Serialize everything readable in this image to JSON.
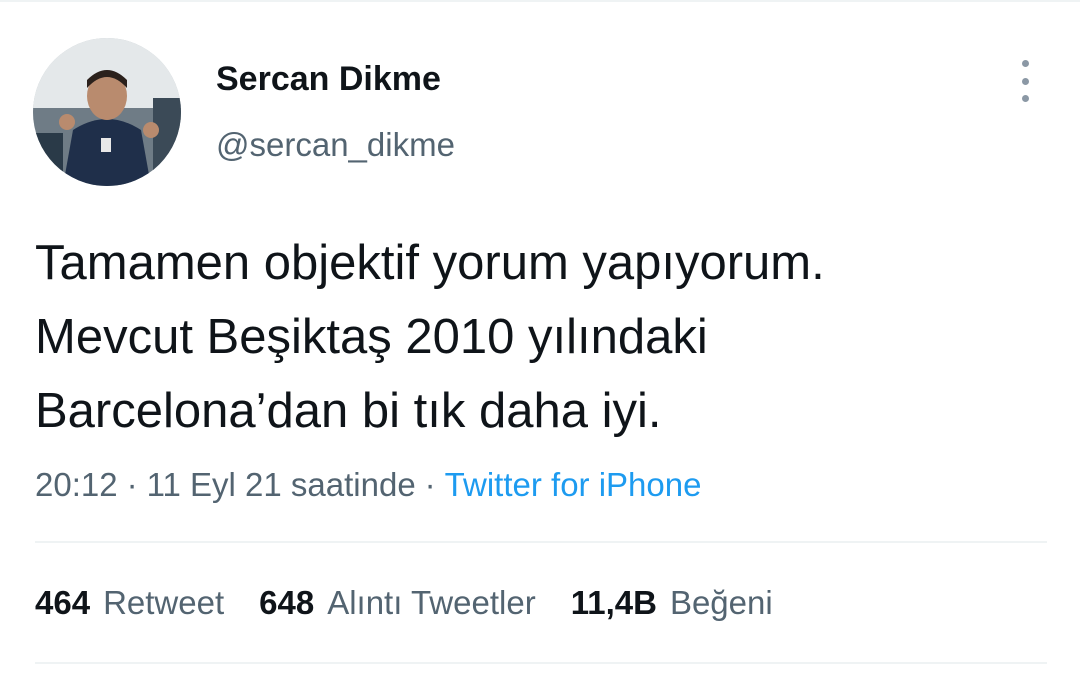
{
  "author": {
    "display_name": "Sercan Dikme",
    "handle": "@sercan_dikme",
    "avatar_icon": "profile-photo"
  },
  "tweet": {
    "lines": [
      "Tamamen objektif yorum yapıyorum.",
      "Mevcut Beşiktaş 2010 yılındaki",
      "Barcelona’dan bi tık daha iyi."
    ]
  },
  "meta": {
    "time": "20:12",
    "separator": "·",
    "date": "11 Eyl 21 saatinde",
    "source": "Twitter for iPhone"
  },
  "stats": [
    {
      "count": "464",
      "label": "Retweet"
    },
    {
      "count": "648",
      "label": "Alıntı Tweetler"
    },
    {
      "count": "11,4B",
      "label": "Beğeni"
    }
  ],
  "colors": {
    "text_primary": "#0f1419",
    "text_secondary": "#536471",
    "link": "#1d9bf0",
    "divider": "#eff3f4"
  },
  "icons": {
    "more": "more-vertical-icon"
  }
}
